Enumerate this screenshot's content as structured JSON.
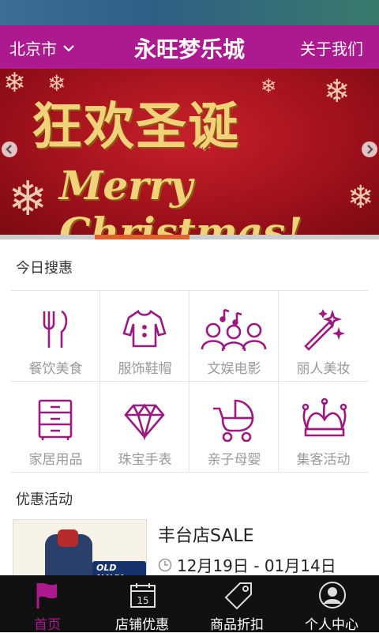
{
  "header": {
    "city": "北京市",
    "title": "永旺梦乐城",
    "about": "关于我们"
  },
  "banner": {
    "headline_cn": "狂欢圣诞",
    "headline_en": "Merry Christmas!",
    "progress": 0.25
  },
  "today": {
    "title": "今日搜惠",
    "categories": [
      {
        "label": "餐饮美食",
        "icon": "utensils-icon"
      },
      {
        "label": "服饰鞋帽",
        "icon": "shirt-icon"
      },
      {
        "label": "文娱电影",
        "icon": "people-music-icon"
      },
      {
        "label": "丽人美妆",
        "icon": "magic-wand-icon"
      },
      {
        "label": "家居用品",
        "icon": "cabinet-icon"
      },
      {
        "label": "珠宝手表",
        "icon": "diamond-icon"
      },
      {
        "label": "亲子母婴",
        "icon": "stroller-icon"
      },
      {
        "label": "集客活动",
        "icon": "jester-hat-icon"
      }
    ]
  },
  "promo": {
    "title": "优惠活动",
    "item": {
      "name": "丰台店SALE",
      "date": "12月19日 - 01月14日",
      "badge": "OLD NAVY"
    }
  },
  "tabs": [
    {
      "label": "首页",
      "icon": "flag-icon",
      "active": true
    },
    {
      "label": "店铺优惠",
      "icon": "calendar-icon",
      "active": false
    },
    {
      "label": "商品折扣",
      "icon": "tag-icon",
      "active": false
    },
    {
      "label": "个人中心",
      "icon": "user-icon",
      "active": false
    }
  ],
  "calendar_day": "15",
  "colors": {
    "brand": "#ad1a8f",
    "tabbar": "#111111",
    "banner_red": "#a2121c",
    "banner_gold": "#f1d27a",
    "progress": "#e2602b",
    "label_gray": "#999999"
  }
}
